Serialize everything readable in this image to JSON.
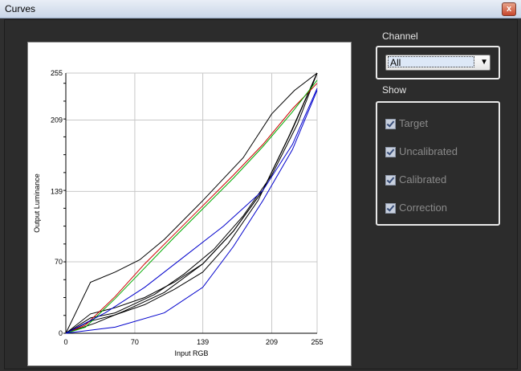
{
  "window": {
    "title": "Curves",
    "close_glyph": "x"
  },
  "channel": {
    "label": "Channel",
    "selected": "All"
  },
  "show": {
    "label": "Show",
    "options": [
      {
        "label": "Target",
        "checked": true
      },
      {
        "label": "Uncalibrated",
        "checked": true
      },
      {
        "label": "Calibrated",
        "checked": true
      },
      {
        "label": "Correction",
        "checked": true
      }
    ]
  },
  "colors": {
    "red": "#cc0000",
    "green": "#00aa00",
    "blue": "#0000cc",
    "black": "#000000"
  },
  "chart_data": {
    "type": "line",
    "xlabel": "Input RGB",
    "ylabel": "Output Luminance",
    "xlim": [
      0,
      255
    ],
    "ylim": [
      0,
      255
    ],
    "xticks": [
      0,
      70,
      139,
      209,
      255
    ],
    "yticks": [
      0,
      70,
      139,
      209,
      255
    ],
    "grid": true,
    "series": [
      {
        "color": "#000000",
        "points": [
          [
            0,
            0
          ],
          [
            25,
            50
          ],
          [
            50,
            60
          ],
          [
            75,
            72
          ],
          [
            100,
            92
          ],
          [
            139,
            130
          ],
          [
            180,
            172
          ],
          [
            209,
            215
          ],
          [
            232,
            238
          ],
          [
            255,
            255
          ]
        ]
      },
      {
        "color": "#000000",
        "points": [
          [
            0,
            0
          ],
          [
            25,
            19
          ],
          [
            50,
            25
          ],
          [
            80,
            35
          ],
          [
            110,
            50
          ],
          [
            139,
            68
          ],
          [
            170,
            100
          ],
          [
            200,
            140
          ],
          [
            230,
            200
          ],
          [
            255,
            255
          ]
        ]
      },
      {
        "color": "#000000",
        "points": [
          [
            0,
            0
          ],
          [
            25,
            15
          ],
          [
            50,
            20
          ],
          [
            90,
            38
          ],
          [
            120,
            58
          ],
          [
            150,
            82
          ],
          [
            180,
            115
          ],
          [
            209,
            155
          ],
          [
            235,
            205
          ],
          [
            255,
            255
          ]
        ]
      },
      {
        "color": "#000000",
        "points": [
          [
            0,
            0
          ],
          [
            25,
            12
          ],
          [
            50,
            18
          ],
          [
            80,
            28
          ],
          [
            110,
            43
          ],
          [
            139,
            60
          ],
          [
            165,
            88
          ],
          [
            195,
            130
          ],
          [
            225,
            190
          ],
          [
            255,
            255
          ]
        ]
      },
      {
        "color": "#000000",
        "points": [
          [
            0,
            0
          ],
          [
            30,
            10
          ],
          [
            60,
            22
          ],
          [
            100,
            40
          ],
          [
            139,
            68
          ],
          [
            170,
            100
          ],
          [
            200,
            140
          ],
          [
            230,
            200
          ],
          [
            255,
            255
          ]
        ]
      },
      {
        "color": "#cc0000",
        "points": [
          [
            0,
            0
          ],
          [
            20,
            8
          ],
          [
            50,
            36
          ],
          [
            80,
            68
          ],
          [
            110,
            97
          ],
          [
            139,
            125
          ],
          [
            170,
            155
          ],
          [
            200,
            185
          ],
          [
            230,
            220
          ],
          [
            255,
            245
          ]
        ]
      },
      {
        "color": "#00aa00",
        "points": [
          [
            0,
            0
          ],
          [
            20,
            6
          ],
          [
            50,
            34
          ],
          [
            80,
            64
          ],
          [
            110,
            94
          ],
          [
            139,
            122
          ],
          [
            170,
            152
          ],
          [
            200,
            183
          ],
          [
            230,
            217
          ],
          [
            255,
            248
          ]
        ]
      },
      {
        "color": "#0000cc",
        "points": [
          [
            0,
            0
          ],
          [
            40,
            20
          ],
          [
            80,
            45
          ],
          [
            120,
            75
          ],
          [
            160,
            105
          ],
          [
            200,
            140
          ],
          [
            230,
            185
          ],
          [
            255,
            240
          ]
        ]
      },
      {
        "color": "#0000cc",
        "points": [
          [
            0,
            0
          ],
          [
            50,
            6
          ],
          [
            100,
            20
          ],
          [
            139,
            45
          ],
          [
            170,
            85
          ],
          [
            200,
            130
          ],
          [
            230,
            180
          ],
          [
            255,
            238
          ]
        ]
      }
    ]
  }
}
